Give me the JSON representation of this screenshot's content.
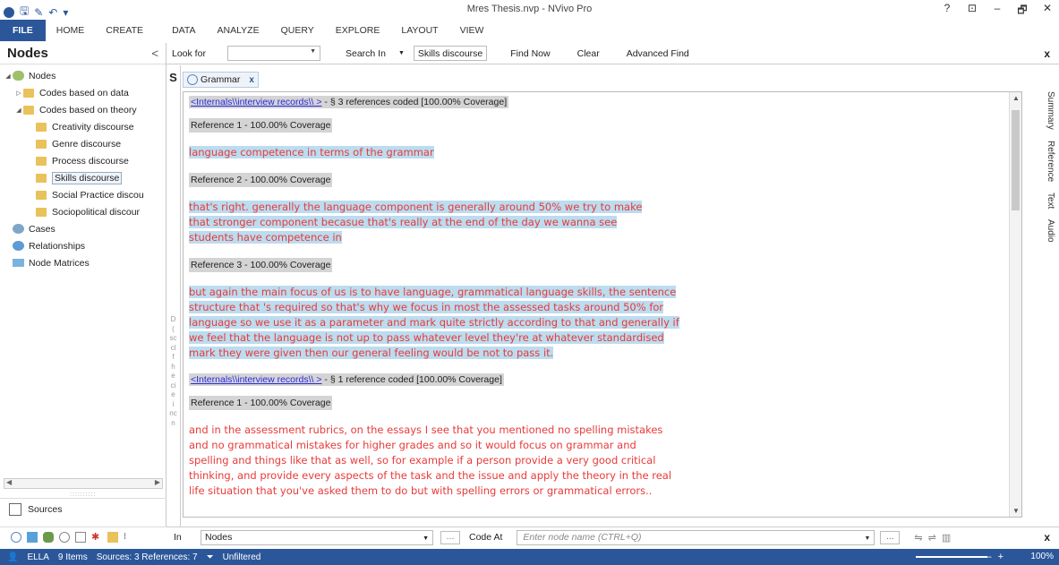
{
  "window": {
    "title": "Mres Thesis.nvp - NVivo Pro",
    "controls": [
      "?",
      "⊡",
      "–",
      "🗗",
      "✕"
    ]
  },
  "ribbon": {
    "tabs": [
      "FILE",
      "HOME",
      "CREATE",
      "DATA",
      "ANALYZE",
      "QUERY",
      "EXPLORE",
      "LAYOUT",
      "VIEW"
    ]
  },
  "nav": {
    "title": "Nodes",
    "collapse": "<",
    "tree": [
      {
        "label": "Nodes",
        "level": 0,
        "icon": "nodes-icon",
        "expand": "◢"
      },
      {
        "label": "Codes based on data",
        "level": 1,
        "icon": "folder-icon",
        "expand": "▷"
      },
      {
        "label": "Codes based on theory",
        "level": 1,
        "icon": "folder-icon",
        "expand": "◢"
      },
      {
        "label": "Creativity discourse",
        "level": 2,
        "icon": "folder-icon"
      },
      {
        "label": "Genre discourse",
        "level": 2,
        "icon": "folder-icon"
      },
      {
        "label": "Process discourse",
        "level": 2,
        "icon": "folder-icon"
      },
      {
        "label": "Skills discourse",
        "level": 2,
        "icon": "folder-icon",
        "selected": true
      },
      {
        "label": "Social Practice discou",
        "level": 2,
        "icon": "folder-icon"
      },
      {
        "label": "Sociopolitical discour",
        "level": 2,
        "icon": "folder-icon"
      },
      {
        "label": "Cases",
        "level": 0,
        "icon": "cases-icon"
      },
      {
        "label": "Relationships",
        "level": 0,
        "icon": "relationships-icon"
      },
      {
        "label": "Node Matrices",
        "level": 0,
        "icon": "matrices-icon"
      }
    ],
    "grip": "::::::::::",
    "sources_label": "Sources"
  },
  "findbar": {
    "look_for": "Look for",
    "search_in": "Search In",
    "search_in_value": "Skills discourse",
    "find_now": "Find Now",
    "clear": "Clear",
    "advanced_find": "Advanced Find",
    "close": "x"
  },
  "liststrip": {
    "s": "S",
    "fragments": [
      "D",
      "(",
      "sc",
      "cl",
      "f",
      "h",
      "e",
      "ci",
      "e",
      "i",
      "nc",
      "n"
    ]
  },
  "detail": {
    "tab_label": "Grammar",
    "tab_close": "x",
    "sections": [
      {
        "link": "<Internals\\\\interview records\\\\        >",
        "summary": "- § 3 references coded  [100.00% Coverage]",
        "refs": [
          {
            "label": "Reference 1 - 100.00% Coverage",
            "text": " language competence in terms of the grammar"
          },
          {
            "label": "Reference 2 - 100.00% Coverage",
            "text": "that's right. generally the language component is generally around 50% we try to make that stronger component becasue that's really at the end of the day we wanna see students have competence in "
          },
          {
            "label": "Reference 3 - 100.00% Coverage",
            "text": "but again the main focus of us is to have language, grammatical language skills, the sentence structure that 's required so that's why we focus in most the assessed tasks around 50% for language so we use it as a parameter and mark quite strictly according to that and generally if we feel that the language is not up to pass whatever level they're at whatever standardised mark they were given then our general feeling would be not to pass it."
          }
        ]
      },
      {
        "link": "<Internals\\\\interview records\\\\        >",
        "summary": "- § 1 reference coded  [100.00% Coverage]",
        "refs": [
          {
            "label": "Reference 1 - 100.00% Coverage",
            "text": " and in the assessment rubrics, on the essays I see that you mentioned no spelling mistakes and no grammatical mistakes for higher grades and so it would focus on grammar and spelling and things like that as well, so for example if a person provide a very good critical thinking, and provide every aspects of the task and the issue and apply the theory in the real life situation that you've asked them to do but with spelling errors or grammatical errors.."
          }
        ]
      }
    ]
  },
  "sidetabs": [
    "Summary",
    "Reference",
    "Text",
    "Audio"
  ],
  "codebar": {
    "in_label": "In",
    "in_value": "Nodes",
    "dots": "...",
    "code_at": "Code At",
    "placeholder": "Enter node name (CTRL+Q)",
    "close": "x"
  },
  "status": {
    "user": "ELLA",
    "items": "9 Items",
    "sources": "Sources: 3  References: 7",
    "filter": "Unfiltered",
    "zoom": "100%"
  },
  "colors": {
    "accent": "#2b579a",
    "quote_text": "#e83a3a",
    "quote_highlight": "#bcdcef",
    "ref_bg": "#d4d4d4",
    "link": "#2a2ae0"
  }
}
